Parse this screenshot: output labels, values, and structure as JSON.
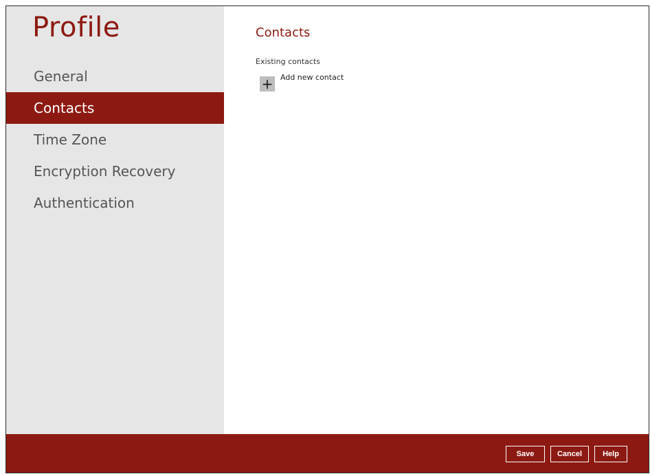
{
  "sidebar": {
    "title": "Profile",
    "items": [
      {
        "label": "General"
      },
      {
        "label": "Contacts"
      },
      {
        "label": "Time Zone"
      },
      {
        "label": "Encryption Recovery"
      },
      {
        "label": "Authentication"
      }
    ],
    "active_item": "Contacts"
  },
  "main": {
    "title": "Contacts",
    "section_label": "Existing contacts",
    "add_icon": "plus-icon",
    "add_label": "Add new contact"
  },
  "footer": {
    "save_label": "Save",
    "cancel_label": "Cancel",
    "help_label": "Help"
  },
  "colors": {
    "accent": "#8c1a12",
    "sidebar_bg": "#e6e6e6"
  }
}
